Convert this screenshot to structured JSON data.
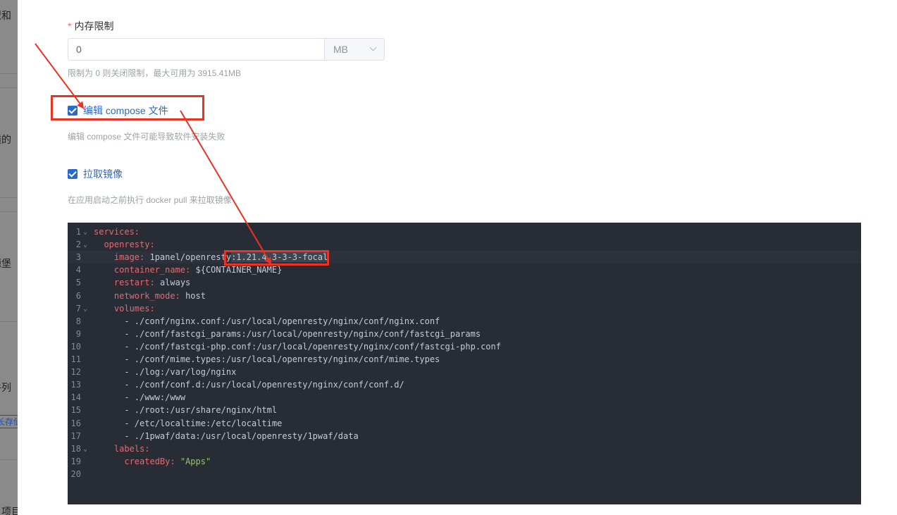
{
  "backdrop": {
    "fragments": [
      "型和",
      "透的",
      "源堡",
      "件列",
      "长存储",
      "项目"
    ]
  },
  "memory": {
    "label": "内存限制",
    "required_mark": "*",
    "value": "0",
    "unit": "MB",
    "help": "限制为 0 则关闭限制，最大可用为 3915.41MB"
  },
  "edit_compose": {
    "label": "编辑 compose 文件",
    "checked": true,
    "help": "编辑 compose 文件可能导致软件安装失败"
  },
  "pull_image": {
    "label": "拉取镜像",
    "checked": true,
    "help": "在应用启动之前执行 docker pull 来拉取镜像"
  },
  "editor": {
    "lines": [
      {
        "n": "1",
        "fold": true,
        "indent": "",
        "key": "services",
        "sep": ":",
        "value": ""
      },
      {
        "n": "2",
        "fold": true,
        "indent": "  ",
        "key": "openresty",
        "sep": ":",
        "value": ""
      },
      {
        "n": "3",
        "fold": false,
        "indent": "    ",
        "key": "image",
        "sep": ": ",
        "value": "1panel/openresty",
        "highlight": ":1.21.4.3-3-3-focal"
      },
      {
        "n": "4",
        "fold": false,
        "indent": "    ",
        "key": "container_name",
        "sep": ": ",
        "value": "${CONTAINER_NAME}"
      },
      {
        "n": "5",
        "fold": false,
        "indent": "    ",
        "key": "restart",
        "sep": ": ",
        "value": "always"
      },
      {
        "n": "6",
        "fold": false,
        "indent": "    ",
        "key": "network_mode",
        "sep": ": ",
        "value": "host"
      },
      {
        "n": "7",
        "fold": true,
        "indent": "    ",
        "key": "volumes",
        "sep": ":",
        "value": ""
      },
      {
        "n": "8",
        "fold": false,
        "indent": "      ",
        "key": "",
        "sep": "",
        "value": "- ./conf/nginx.conf:/usr/local/openresty/nginx/conf/nginx.conf"
      },
      {
        "n": "9",
        "fold": false,
        "indent": "      ",
        "key": "",
        "sep": "",
        "value": "- ./conf/fastcgi_params:/usr/local/openresty/nginx/conf/fastcgi_params"
      },
      {
        "n": "10",
        "fold": false,
        "indent": "      ",
        "key": "",
        "sep": "",
        "value": "- ./conf/fastcgi-php.conf:/usr/local/openresty/nginx/conf/fastcgi-php.conf"
      },
      {
        "n": "11",
        "fold": false,
        "indent": "      ",
        "key": "",
        "sep": "",
        "value": "- ./conf/mime.types:/usr/local/openresty/nginx/conf/mime.types"
      },
      {
        "n": "12",
        "fold": false,
        "indent": "      ",
        "key": "",
        "sep": "",
        "value": "- ./log:/var/log/nginx"
      },
      {
        "n": "13",
        "fold": false,
        "indent": "      ",
        "key": "",
        "sep": "",
        "value": "- ./conf/conf.d:/usr/local/openresty/nginx/conf/conf.d/"
      },
      {
        "n": "14",
        "fold": false,
        "indent": "      ",
        "key": "",
        "sep": "",
        "value": "- ./www:/www"
      },
      {
        "n": "15",
        "fold": false,
        "indent": "      ",
        "key": "",
        "sep": "",
        "value": "- ./root:/usr/share/nginx/html"
      },
      {
        "n": "16",
        "fold": false,
        "indent": "      ",
        "key": "",
        "sep": "",
        "value": "- /etc/localtime:/etc/localtime"
      },
      {
        "n": "17",
        "fold": false,
        "indent": "      ",
        "key": "",
        "sep": "",
        "value": "- ./1pwaf/data:/usr/local/openresty/1pwaf/data"
      },
      {
        "n": "18",
        "fold": true,
        "indent": "    ",
        "key": "labels",
        "sep": ":",
        "value": ""
      },
      {
        "n": "19",
        "fold": false,
        "indent": "      ",
        "key": "createdBy",
        "sep": ": ",
        "value": "",
        "string": "\"Apps\""
      },
      {
        "n": "20",
        "fold": false,
        "indent": "",
        "key": "",
        "sep": "",
        "value": ""
      }
    ]
  }
}
